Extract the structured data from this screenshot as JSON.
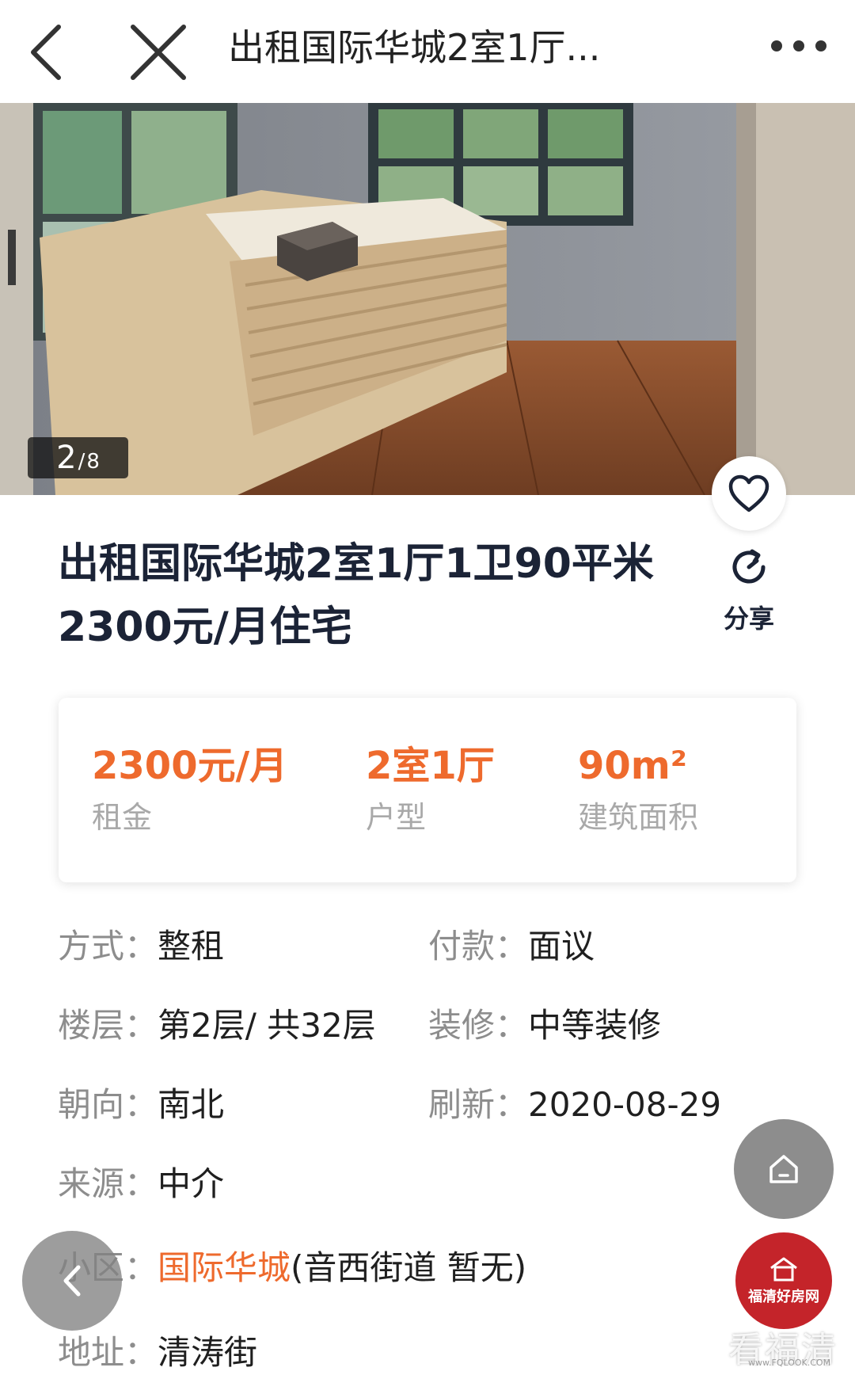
{
  "nav": {
    "title": "出租国际华城2室1厅..."
  },
  "gallery": {
    "current": "2",
    "separator": "/",
    "total": "8"
  },
  "listing": {
    "title_line1": "出租国际华城2室1厅1卫90平米",
    "title_line2": "2300元/月住宅",
    "share_label": "分享"
  },
  "stats": {
    "rent_value": "2300元/月",
    "rent_label": "租金",
    "layout_value": "2室1厅",
    "layout_label": "户型",
    "area_value": "90m²",
    "area_label": "建筑面积"
  },
  "details": {
    "mode_key": "方式：",
    "mode_val": "整租",
    "payment_key": "付款：",
    "payment_val": "面议",
    "floor_key": "楼层：",
    "floor_val": "第2层/ 共32层",
    "decoration_key": "装修：",
    "decoration_val": "中等装修",
    "orientation_key": "朝向：",
    "orientation_val": "南北",
    "refresh_key": "刷新：",
    "refresh_val": "2020-08-29",
    "source_key": "来源：",
    "source_val": "中介",
    "community_key": "小区：",
    "community_link": "国际华城",
    "community_extra": "(音西街道 暂无)",
    "address_key": "地址：",
    "address_val": "清涛街"
  },
  "branding": {
    "logo_text": "福清好房网",
    "watermark": "看福清",
    "watermark_url": "www.FQLOOK.COM"
  },
  "colors": {
    "accent": "#ee6a2d",
    "title_text": "#1b2336",
    "label_grey": "#8d8d8d",
    "brand_red": "#c4242a"
  }
}
